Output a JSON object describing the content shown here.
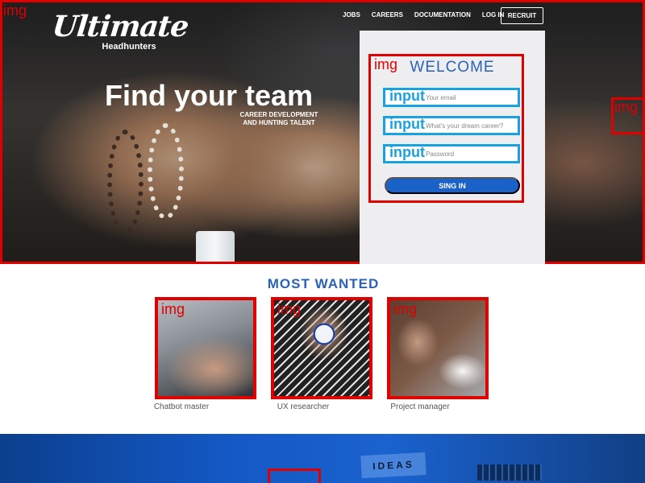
{
  "header": {
    "logo_text": "Ultimate",
    "logo_subtitle": "Headhunters",
    "nav": [
      "JOBS",
      "CAREERS",
      "DOCUMENTATION",
      "LOG IN"
    ],
    "recruit_label": "RECRUIT"
  },
  "hero": {
    "title": "Find your team",
    "subtitle_line1": "CAREER DEVELOPMENT",
    "subtitle_line2": "AND HUNTING TALENT",
    "img_label": "img"
  },
  "login": {
    "welcome": "WELCOME",
    "email_placeholder": "Your email",
    "career_placeholder": "What's your dream career?",
    "password_placeholder": "Password",
    "input_tag": "input",
    "img_tag": "img",
    "signin_label": "SING IN"
  },
  "most_wanted": {
    "title": "MOST WANTED",
    "img_tag": "img",
    "cards": [
      {
        "caption": "Chatbot master"
      },
      {
        "caption": "UX researcher"
      },
      {
        "caption": "Project manager"
      }
    ]
  },
  "banner": {
    "ideas_text": "IDEAS"
  },
  "colors": {
    "accent_blue": "#2a62b8",
    "button_blue": "#1a62c7",
    "annotation_red": "#e00000",
    "annotation_cyan": "#18a3e0"
  }
}
